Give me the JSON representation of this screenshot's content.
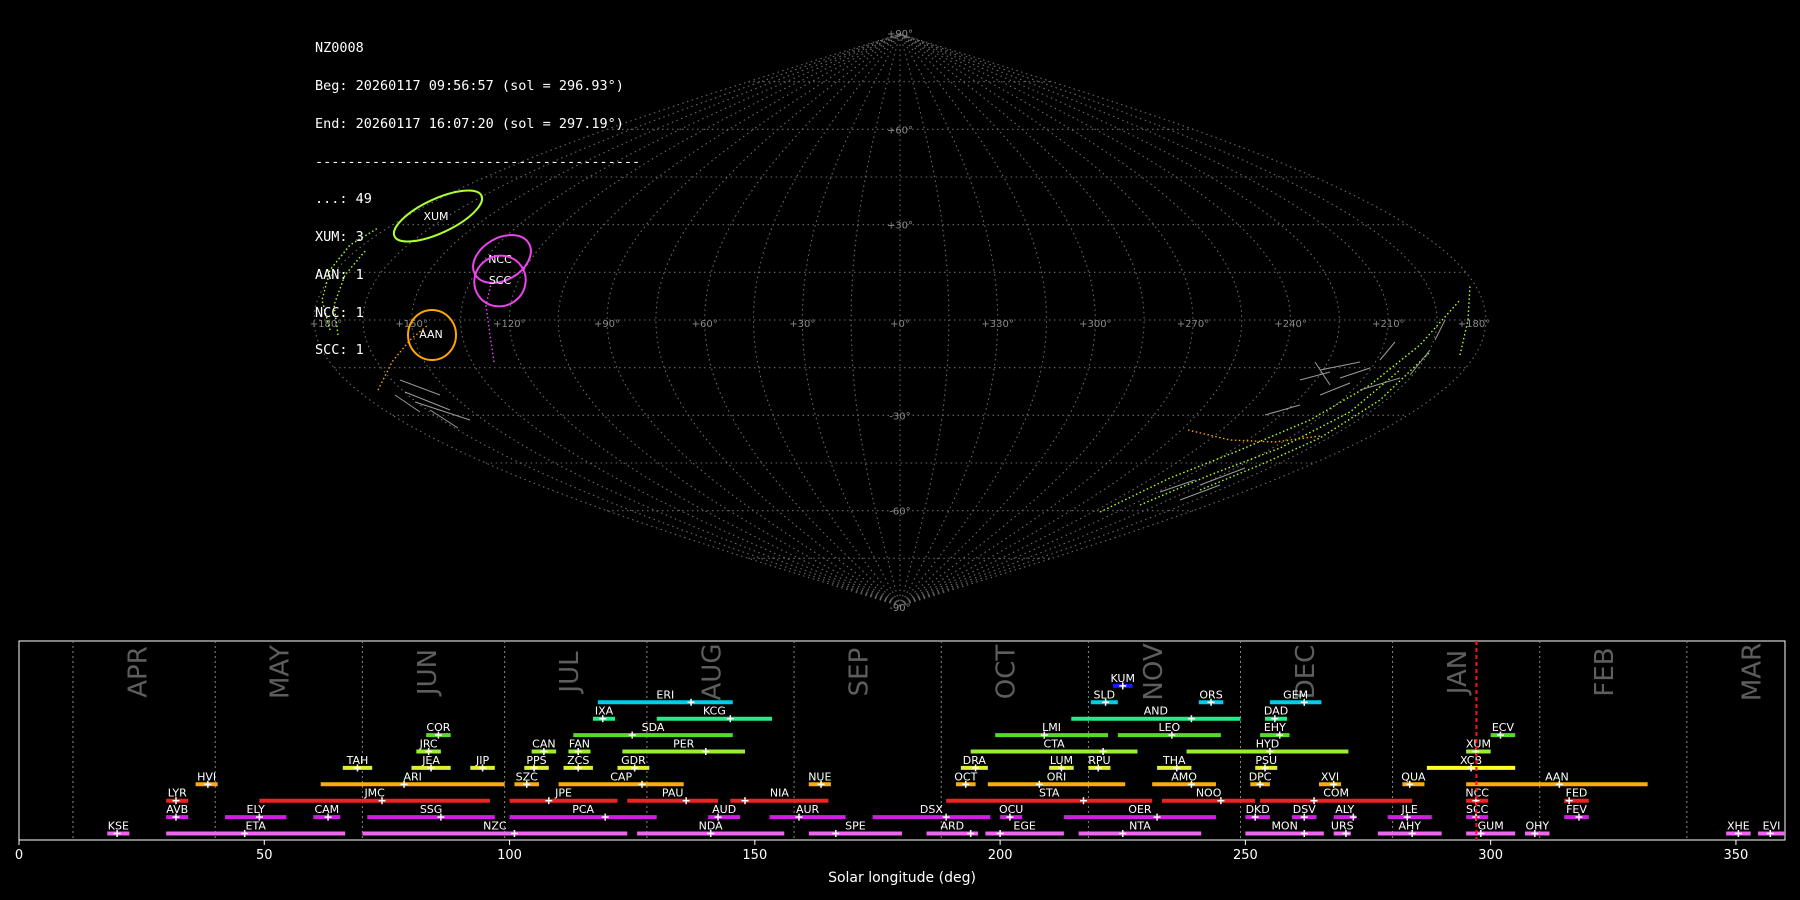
{
  "info": {
    "station": "NZ0008",
    "begin": "Beg: 20260117 09:56:57 (sol = 296.93°)",
    "end": "End: 20260117 16:07:20 (sol = 297.19°)",
    "separator": "----------------------------------------",
    "counts": [
      {
        "label": "...: 49"
      },
      {
        "label": "XUM: 3"
      },
      {
        "label": "AAN: 1"
      },
      {
        "label": "NCC: 1"
      },
      {
        "label": "SCC: 1"
      }
    ]
  },
  "sky_map": {
    "projection": "sinusoidal",
    "ra_ticks": [
      "+180°",
      "+150°",
      "+120°",
      "+90°",
      "+60°",
      "+30°",
      "+0°",
      "+330°",
      "+300°",
      "+270°",
      "+240°",
      "+210°",
      "+180°"
    ],
    "dec_ticks": [
      "+90°",
      "+60°",
      "+30°",
      "-30°",
      "-60°",
      "-90°"
    ],
    "radiants": [
      {
        "name": "XUM",
        "color": "#adff2f"
      },
      {
        "name": "NCC",
        "color": "#ee44ee"
      },
      {
        "name": "SCC",
        "color": "#ee44ee"
      },
      {
        "name": "AAN",
        "color": "#ffa500"
      }
    ]
  },
  "chart_data": {
    "type": "timeline",
    "xlabel": "Solar longitude (deg)",
    "xlim": [
      0,
      360
    ],
    "xticks": [
      0,
      50,
      100,
      150,
      200,
      250,
      300,
      350
    ],
    "months": [
      {
        "name": "APR",
        "sol": 11
      },
      {
        "name": "MAY",
        "sol": 40
      },
      {
        "name": "JUN",
        "sol": 70
      },
      {
        "name": "JUL",
        "sol": 99
      },
      {
        "name": "AUG",
        "sol": 128
      },
      {
        "name": "SEP",
        "sol": 158
      },
      {
        "name": "OCT",
        "sol": 188
      },
      {
        "name": "NOV",
        "sol": 218
      },
      {
        "name": "DEC",
        "sol": 249
      },
      {
        "name": "JAN",
        "sol": 280
      },
      {
        "name": "FEB",
        "sol": 310
      },
      {
        "name": "MAR",
        "sol": 340
      }
    ],
    "current_sol": 297.1,
    "rows": 11,
    "showers": [
      {
        "code": "KUM",
        "start": 223,
        "end": 227,
        "peak": 225,
        "row": 10,
        "color": "#1a1aff"
      },
      {
        "code": "ERI",
        "start": 118,
        "end": 145.5,
        "peak": 137,
        "row": 9,
        "color": "#00ccee"
      },
      {
        "code": "SLD",
        "start": 218.5,
        "end": 224,
        "peak": 221.5,
        "row": 9,
        "color": "#00ccee"
      },
      {
        "code": "ORS",
        "start": 240.5,
        "end": 245.5,
        "peak": 243,
        "row": 9,
        "color": "#00ccee"
      },
      {
        "code": "GEM",
        "start": 255,
        "end": 265.5,
        "peak": 262,
        "row": 9,
        "color": "#00ccee"
      },
      {
        "code": "IXA",
        "start": 117,
        "end": 121.5,
        "peak": 119,
        "row": 8,
        "color": "#22ee88"
      },
      {
        "code": "KCG",
        "start": 130,
        "end": 153.5,
        "peak": 145,
        "row": 8,
        "color": "#22ee88"
      },
      {
        "code": "AND",
        "start": 214.5,
        "end": 249,
        "peak": 239,
        "row": 8,
        "color": "#22ee88"
      },
      {
        "code": "DAD",
        "start": 254,
        "end": 258.5,
        "peak": 256,
        "row": 8,
        "color": "#22ee88"
      },
      {
        "code": "COR",
        "start": 83,
        "end": 88,
        "peak": 85.5,
        "row": 7,
        "color": "#55dd22"
      },
      {
        "code": "SDA",
        "start": 113,
        "end": 145.5,
        "peak": 125,
        "row": 7,
        "color": "#55dd22"
      },
      {
        "code": "LMI",
        "start": 199,
        "end": 222,
        "peak": 209,
        "row": 7,
        "color": "#55dd22"
      },
      {
        "code": "LEO",
        "start": 224,
        "end": 245,
        "peak": 235,
        "row": 7,
        "color": "#55dd22"
      },
      {
        "code": "EHY",
        "start": 253,
        "end": 259,
        "peak": 257,
        "row": 7,
        "color": "#55dd22"
      },
      {
        "code": "ECV",
        "start": 300,
        "end": 305,
        "peak": 302,
        "row": 7,
        "color": "#55dd22"
      },
      {
        "code": "JRC",
        "start": 81,
        "end": 86,
        "peak": 83.5,
        "row": 6,
        "color": "#99ee33"
      },
      {
        "code": "CAN",
        "start": 104.5,
        "end": 109.5,
        "peak": 107,
        "row": 6,
        "color": "#99ee33"
      },
      {
        "code": "FAN",
        "start": 112,
        "end": 116.5,
        "peak": 114,
        "row": 6,
        "color": "#99ee33"
      },
      {
        "code": "PER",
        "start": 123,
        "end": 148,
        "peak": 140,
        "row": 6,
        "color": "#99ee33"
      },
      {
        "code": "CTA",
        "start": 194,
        "end": 228,
        "peak": 221,
        "row": 6,
        "color": "#99ee33"
      },
      {
        "code": "HYD",
        "start": 238,
        "end": 271,
        "peak": 255,
        "row": 6,
        "color": "#99ee33"
      },
      {
        "code": "XUM",
        "start": 295,
        "end": 300,
        "peak": 297,
        "row": 6,
        "color": "#99ee33"
      },
      {
        "code": "TAH",
        "start": 66,
        "end": 72,
        "peak": 69,
        "row": 5,
        "color": "#ddee33"
      },
      {
        "code": "JEA",
        "start": 80,
        "end": 88,
        "peak": 84,
        "row": 5,
        "color": "#ddee33"
      },
      {
        "code": "JIP",
        "start": 92,
        "end": 97,
        "peak": 94.5,
        "row": 5,
        "color": "#ddee33"
      },
      {
        "code": "PPS",
        "start": 103,
        "end": 108,
        "peak": 105,
        "row": 5,
        "color": "#ddee33"
      },
      {
        "code": "ZCS",
        "start": 111,
        "end": 117,
        "peak": 114,
        "row": 5,
        "color": "#ddee33"
      },
      {
        "code": "GDR",
        "start": 122,
        "end": 128.5,
        "peak": 125.5,
        "row": 5,
        "color": "#ddee33"
      },
      {
        "code": "DRA",
        "start": 192,
        "end": 197.5,
        "peak": 195,
        "row": 5,
        "color": "#ddee33"
      },
      {
        "code": "LUM",
        "start": 210,
        "end": 215,
        "peak": 212.5,
        "row": 5,
        "color": "#ddee33"
      },
      {
        "code": "RPU",
        "start": 218,
        "end": 222.5,
        "peak": 220,
        "row": 5,
        "color": "#ddee33"
      },
      {
        "code": "THA",
        "start": 232,
        "end": 239,
        "peak": 236,
        "row": 5,
        "color": "#ddee33"
      },
      {
        "code": "PSU",
        "start": 252,
        "end": 256.5,
        "peak": 254,
        "row": 5,
        "color": "#ddee33"
      },
      {
        "code": "XCB",
        "start": 287,
        "end": 305,
        "peak": 296,
        "row": 5,
        "color": "#ffff22"
      },
      {
        "code": "HVI",
        "start": 36,
        "end": 40.5,
        "peak": 38.5,
        "row": 4,
        "color": "#ffaa11"
      },
      {
        "code": "ARI",
        "start": 61.5,
        "end": 99,
        "peak": 78.5,
        "row": 4,
        "color": "#ffaa11"
      },
      {
        "code": "SZC",
        "start": 101,
        "end": 106,
        "peak": 103.5,
        "row": 4,
        "color": "#ffaa11"
      },
      {
        "code": "CAP",
        "start": 110,
        "end": 135.5,
        "peak": 127,
        "row": 4,
        "color": "#ffaa11"
      },
      {
        "code": "NUE",
        "start": 161,
        "end": 165.5,
        "peak": 163.5,
        "row": 4,
        "color": "#ffaa11"
      },
      {
        "code": "OCT",
        "start": 191,
        "end": 195,
        "peak": 193,
        "row": 4,
        "color": "#ffaa11"
      },
      {
        "code": "ORI",
        "start": 197.5,
        "end": 225.5,
        "peak": 208,
        "row": 4,
        "color": "#ffaa11"
      },
      {
        "code": "AMO",
        "start": 231,
        "end": 244,
        "peak": 239,
        "row": 4,
        "color": "#ffaa11"
      },
      {
        "code": "DPC",
        "start": 251,
        "end": 255,
        "peak": 253,
        "row": 4,
        "color": "#ffaa11"
      },
      {
        "code": "XVI",
        "start": 265,
        "end": 269.5,
        "peak": 268,
        "row": 4,
        "color": "#ffaa11"
      },
      {
        "code": "QUA",
        "start": 282,
        "end": 286.5,
        "peak": 283.5,
        "row": 4,
        "color": "#ffaa11"
      },
      {
        "code": "AAN",
        "start": 295,
        "end": 332,
        "peak": 314,
        "row": 4,
        "color": "#ffaa11"
      },
      {
        "code": "LYR",
        "start": 30,
        "end": 34.5,
        "peak": 32,
        "row": 3,
        "color": "#ee2222"
      },
      {
        "code": "JMC",
        "start": 49,
        "end": 96,
        "peak": 74,
        "row": 3,
        "color": "#ee2222"
      },
      {
        "code": "JPE",
        "start": 100,
        "end": 122,
        "peak": 108,
        "row": 3,
        "color": "#ee2222"
      },
      {
        "code": "PAU",
        "start": 124,
        "end": 142.5,
        "peak": 136,
        "row": 3,
        "color": "#ee2222"
      },
      {
        "code": "NIA",
        "start": 145,
        "end": 165,
        "peak": 148,
        "row": 3,
        "color": "#ee2222"
      },
      {
        "code": "STA",
        "start": 189,
        "end": 231,
        "peak": 217,
        "row": 3,
        "color": "#ee2222"
      },
      {
        "code": "NOO",
        "start": 233,
        "end": 252,
        "peak": 245,
        "row": 3,
        "color": "#ee2222"
      },
      {
        "code": "COM",
        "start": 253,
        "end": 284,
        "peak": 264,
        "row": 3,
        "color": "#ee2222"
      },
      {
        "code": "NCC",
        "start": 295,
        "end": 299.5,
        "peak": 297,
        "row": 3,
        "color": "#ee2222"
      },
      {
        "code": "FED",
        "start": 315,
        "end": 320,
        "peak": 316,
        "row": 3,
        "color": "#ee2222"
      },
      {
        "code": "AVB",
        "start": 30,
        "end": 34.5,
        "peak": 32,
        "row": 2,
        "color": "#cc22dd"
      },
      {
        "code": "ELY",
        "start": 42,
        "end": 54.5,
        "peak": 49,
        "row": 2,
        "color": "#cc22dd"
      },
      {
        "code": "CAM",
        "start": 60,
        "end": 65.5,
        "peak": 63,
        "row": 2,
        "color": "#cc22dd"
      },
      {
        "code": "SSG",
        "start": 71,
        "end": 97,
        "peak": 86,
        "row": 2,
        "color": "#cc22dd"
      },
      {
        "code": "PCA",
        "start": 100,
        "end": 130,
        "peak": 119.5,
        "row": 2,
        "color": "#cc22dd"
      },
      {
        "code": "AUD",
        "start": 140.5,
        "end": 147,
        "peak": 142.5,
        "row": 2,
        "color": "#cc22dd"
      },
      {
        "code": "AUR",
        "start": 153,
        "end": 168.5,
        "peak": 159,
        "row": 2,
        "color": "#cc22dd"
      },
      {
        "code": "DSX",
        "start": 174,
        "end": 198,
        "peak": 189,
        "row": 2,
        "color": "#cc22dd"
      },
      {
        "code": "OCU",
        "start": 200,
        "end": 204.5,
        "peak": 202,
        "row": 2,
        "color": "#cc22dd"
      },
      {
        "code": "OER",
        "start": 213,
        "end": 244,
        "peak": 232,
        "row": 2,
        "color": "#cc22dd"
      },
      {
        "code": "DKD",
        "start": 250,
        "end": 255,
        "peak": 252,
        "row": 2,
        "color": "#cc22dd"
      },
      {
        "code": "DSV",
        "start": 259.5,
        "end": 264.5,
        "peak": 262,
        "row": 2,
        "color": "#cc22dd"
      },
      {
        "code": "ALY",
        "start": 268,
        "end": 272.5,
        "peak": 272,
        "row": 2,
        "color": "#cc22dd"
      },
      {
        "code": "JLE",
        "start": 279,
        "end": 288,
        "peak": 283,
        "row": 2,
        "color": "#cc22dd"
      },
      {
        "code": "SCC",
        "start": 295,
        "end": 299.5,
        "peak": 297,
        "row": 2,
        "color": "#cc22dd"
      },
      {
        "code": "FEV",
        "start": 315,
        "end": 320,
        "peak": 318,
        "row": 2,
        "color": "#cc22dd"
      },
      {
        "code": "KSE",
        "start": 18,
        "end": 22.5,
        "peak": 20,
        "row": 1,
        "color": "#ee66ee"
      },
      {
        "code": "ETA",
        "start": 30,
        "end": 66.5,
        "peak": 46,
        "row": 1,
        "color": "#ee66ee"
      },
      {
        "code": "NZC",
        "start": 70,
        "end": 124,
        "peak": 101,
        "row": 1,
        "color": "#ee66ee"
      },
      {
        "code": "NDA",
        "start": 126,
        "end": 156,
        "peak": 141,
        "row": 1,
        "color": "#ee66ee"
      },
      {
        "code": "SPE",
        "start": 161,
        "end": 180,
        "peak": 166.5,
        "row": 1,
        "color": "#ee66ee"
      },
      {
        "code": "ARD",
        "start": 185,
        "end": 195.5,
        "peak": 194,
        "row": 1,
        "color": "#ee66ee"
      },
      {
        "code": "EGE",
        "start": 197,
        "end": 213,
        "peak": 200,
        "row": 1,
        "color": "#ee66ee"
      },
      {
        "code": "NTA",
        "start": 216,
        "end": 241,
        "peak": 225,
        "row": 1,
        "color": "#ee66ee"
      },
      {
        "code": "MON",
        "start": 250,
        "end": 266,
        "peak": 262,
        "row": 1,
        "color": "#ee66ee"
      },
      {
        "code": "URS",
        "start": 268,
        "end": 271.5,
        "peak": 270.5,
        "row": 1,
        "color": "#ee66ee"
      },
      {
        "code": "AHY",
        "start": 277,
        "end": 290,
        "peak": 284,
        "row": 1,
        "color": "#ee66ee"
      },
      {
        "code": "GUM",
        "start": 295,
        "end": 305,
        "peak": 298,
        "row": 1,
        "color": "#ee66ee"
      },
      {
        "code": "OHY",
        "start": 307,
        "end": 312,
        "peak": 309,
        "row": 1,
        "color": "#ee66ee"
      },
      {
        "code": "XHE",
        "start": 348,
        "end": 353,
        "peak": 350.5,
        "row": 1,
        "color": "#ee66ee"
      },
      {
        "code": "EVI",
        "start": 354.5,
        "end": 360,
        "peak": 357,
        "row": 1,
        "color": "#ee66ee"
      }
    ]
  }
}
